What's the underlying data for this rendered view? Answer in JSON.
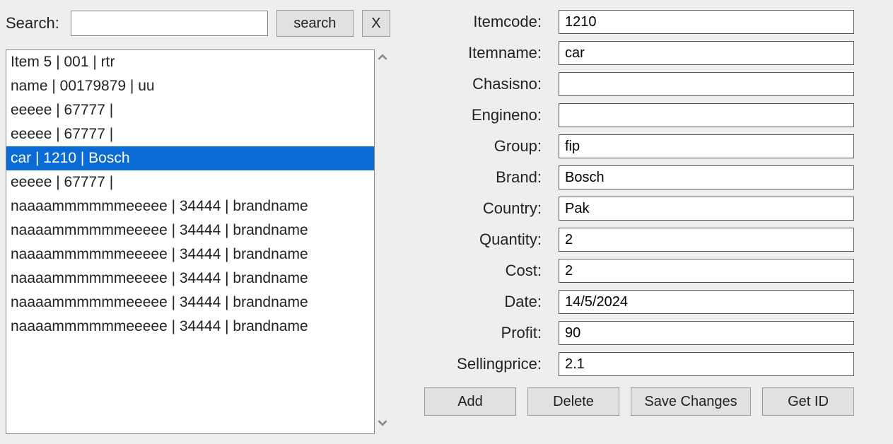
{
  "search": {
    "label": "Search:",
    "value": "",
    "search_button": "search",
    "clear_button": "X"
  },
  "listbox": {
    "selected_index": 4,
    "items": [
      "Item 5 | 001 | rtr",
      "name | 00179879 | uu",
      "eeeee | 67777 |",
      "eeeee | 67777 |",
      "car | 1210 | Bosch",
      "eeeee | 67777 |",
      "naaaammmmmmeeeee | 34444 | brandname",
      "naaaammmmmmeeeee | 34444 | brandname",
      "naaaammmmmmeeeee | 34444 | brandname",
      "naaaammmmmmeeeee | 34444 | brandname",
      "naaaammmmmmeeeee | 34444 | brandname",
      "naaaammmmmmeeeee | 34444 | brandname"
    ]
  },
  "form": {
    "fields": [
      {
        "key": "itemcode",
        "label": "Itemcode:",
        "value": "1210"
      },
      {
        "key": "itemname",
        "label": "Itemname:",
        "value": "car"
      },
      {
        "key": "chasisno",
        "label": "Chasisno:",
        "value": ""
      },
      {
        "key": "engineno",
        "label": "Engineno:",
        "value": ""
      },
      {
        "key": "group",
        "label": "Group:",
        "value": "fip"
      },
      {
        "key": "brand",
        "label": "Brand:",
        "value": "Bosch"
      },
      {
        "key": "country",
        "label": "Country:",
        "value": "Pak"
      },
      {
        "key": "quantity",
        "label": "Quantity:",
        "value": "2"
      },
      {
        "key": "cost",
        "label": "Cost:",
        "value": "2"
      },
      {
        "key": "date",
        "label": "Date:",
        "value": "14/5/2024"
      },
      {
        "key": "profit",
        "label": "Profit:",
        "value": "90"
      },
      {
        "key": "sellingprice",
        "label": "Sellingprice:",
        "value": "2.1"
      }
    ]
  },
  "actions": {
    "add": "Add",
    "delete": "Delete",
    "save": "Save Changes",
    "getid": "Get ID"
  }
}
